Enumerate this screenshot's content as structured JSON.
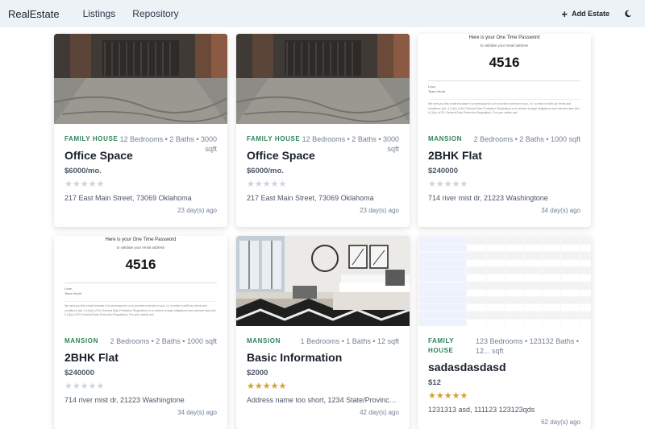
{
  "nav": {
    "brand": "RealEstate",
    "links": [
      "Listings",
      "Repository"
    ],
    "add_label": "Add Estate"
  },
  "email_image": {
    "heading": "Here is your One Time Password",
    "subheading": "to validate your email address",
    "otp": "4516",
    "signoff": "Love,",
    "team": "Team Vecht",
    "footer": "We sent you this email because it is necessary for us to provide a service to you, i.e. to enter to fulfil our terms and conditions (Art. 6 (1)(b) of EU General Data Protection Regulation) or to adhere to legal obligations and relevant laws (Art. 6 (1)(c) of EU General Data Protection Regulation). For your safety and"
  },
  "listings": [
    {
      "type": "FAMILY HOUSE",
      "specs": "12 Bedrooms • 2 Baths • 3000 sqft",
      "title": "Office Space",
      "price": "$6000/mo.",
      "rating": 0,
      "address": "217 East Main Street, 73069 Oklahoma",
      "age": "23 day(s) ago",
      "image": "street"
    },
    {
      "type": "FAMILY HOUSE",
      "specs": "12 Bedrooms • 2 Baths • 3000 sqft",
      "title": "Office Space",
      "price": "$6000/mo.",
      "rating": 0,
      "address": "217 East Main Street, 73069 Oklahoma",
      "age": "23 day(s) ago",
      "image": "street"
    },
    {
      "type": "MANSION",
      "specs": "2 Bedrooms • 2 Baths • 1000 sqft",
      "title": "2BHK Flat",
      "price": "$240000",
      "rating": 0,
      "address": "714 river mist dr, 21223 Washingtone",
      "age": "34 day(s) ago",
      "image": "email"
    },
    {
      "type": "MANSION",
      "specs": "2 Bedrooms • 2 Baths • 1000 sqft",
      "title": "2BHK Flat",
      "price": "$240000",
      "rating": 0,
      "address": "714 river mist dr, 21223 Washingtone",
      "age": "34 day(s) ago",
      "image": "email"
    },
    {
      "type": "MANSION",
      "specs": "1 Bedrooms • 1 Baths • 12 sqft",
      "title": "Basic Information",
      "price": "$2000",
      "rating": 5,
      "address": "Address name too short, 1234 State/Province...",
      "age": "42 day(s) ago",
      "image": "bedroom"
    },
    {
      "type": "FAMILY HOUSE",
      "specs": "123 Bedrooms • 123132 Baths • 12... sqft",
      "title": "sadasdasdasd",
      "price": "$12",
      "rating": 5,
      "address": "1231313 asd, 111123 123123qds",
      "age": "62 day(s) ago",
      "image": "table"
    }
  ],
  "colors": {
    "accent": "#2f855a",
    "star_on": "#d69e2e",
    "star_off": "#cbd5e0",
    "navbar": "#edf2f7"
  }
}
